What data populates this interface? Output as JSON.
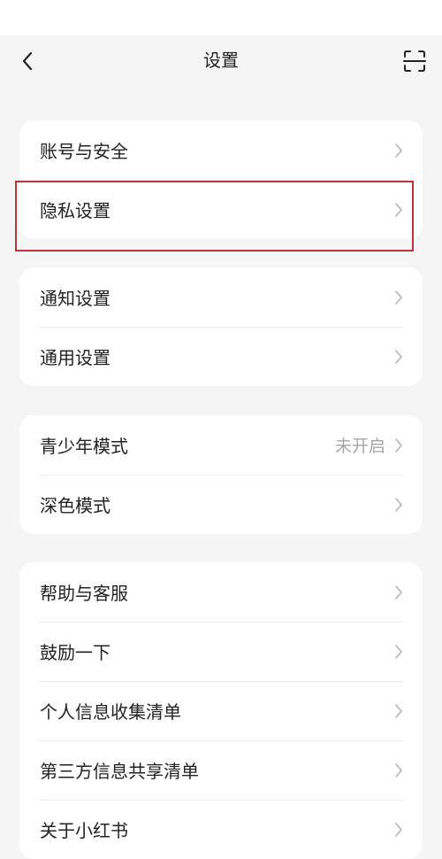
{
  "header": {
    "title": "设置"
  },
  "icons": {
    "back": "chevron-left-icon",
    "scan": "scan-icon",
    "row_arrow": "chevron-right-icon"
  },
  "colors": {
    "highlight": "#c0353b",
    "background": "#f5f5f5",
    "card": "#ffffff"
  },
  "groups": [
    {
      "items": [
        {
          "label": "账号与安全"
        },
        {
          "label": "隐私设置",
          "highlighted": true
        }
      ]
    },
    {
      "items": [
        {
          "label": "通知设置"
        },
        {
          "label": "通用设置"
        }
      ]
    },
    {
      "items": [
        {
          "label": "青少年模式",
          "value": "未开启"
        },
        {
          "label": "深色模式"
        }
      ]
    },
    {
      "items": [
        {
          "label": "帮助与客服"
        },
        {
          "label": "鼓励一下"
        },
        {
          "label": "个人信息收集清单"
        },
        {
          "label": "第三方信息共享清单"
        },
        {
          "label": "关于小红书"
        }
      ]
    }
  ]
}
